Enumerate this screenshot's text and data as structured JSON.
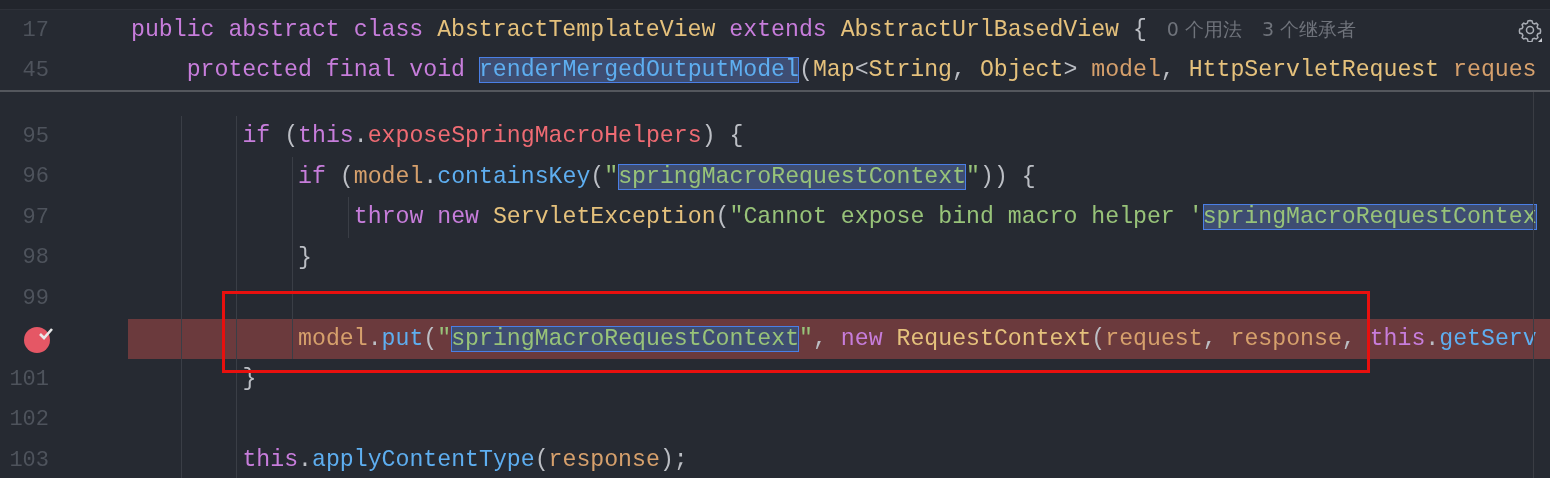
{
  "sticky_lines": [
    {
      "number": "17",
      "tokens": [
        {
          "kind": "kw",
          "text": "public abstract class "
        },
        {
          "kind": "cls",
          "text": "AbstractTemplateView "
        },
        {
          "kind": "kw",
          "text": "extends "
        },
        {
          "kind": "cls",
          "text": "AbstractUrlBasedView "
        },
        {
          "kind": "plain",
          "text": "{"
        }
      ],
      "hints": [
        "0 个用法",
        "3 个继承者"
      ],
      "children": [
        {
          "number": "45",
          "tokens": [
            {
              "kind": "kw",
              "text": "protected final void "
            },
            {
              "kind": "method",
              "text": "renderMergedOutputModel",
              "highlight": true
            },
            {
              "kind": "plain",
              "text": "("
            },
            {
              "kind": "cls",
              "text": "Map"
            },
            {
              "kind": "plain",
              "text": "<"
            },
            {
              "kind": "cls",
              "text": "String"
            },
            {
              "kind": "plain",
              "text": ", "
            },
            {
              "kind": "cls",
              "text": "Object"
            },
            {
              "kind": "plain",
              "text": "> "
            },
            {
              "kind": "param",
              "text": "model"
            },
            {
              "kind": "plain",
              "text": ", "
            },
            {
              "kind": "cls",
              "text": "HttpServletRequest "
            },
            {
              "kind": "param",
              "text": "reques"
            }
          ]
        }
      ]
    }
  ],
  "lines": [
    {
      "number": "95",
      "breakpoint": false,
      "tokens": [
        {
          "kind": "kw",
          "text": "if "
        },
        {
          "kind": "plain",
          "text": "("
        },
        {
          "kind": "kw",
          "text": "this"
        },
        {
          "kind": "plain",
          "text": "."
        },
        {
          "kind": "field",
          "text": "exposeSpringMacroHelpers"
        },
        {
          "kind": "plain",
          "text": ") {"
        }
      ],
      "children": [
        {
          "number": "96",
          "breakpoint": false,
          "tokens": [
            {
              "kind": "kw",
              "text": "if "
            },
            {
              "kind": "plain",
              "text": "("
            },
            {
              "kind": "param",
              "text": "model"
            },
            {
              "kind": "plain",
              "text": "."
            },
            {
              "kind": "method",
              "text": "containsKey"
            },
            {
              "kind": "plain",
              "text": "("
            },
            {
              "kind": "str",
              "text": "\""
            },
            {
              "kind": "str",
              "text": "springMacroRequestContext",
              "highlight": true
            },
            {
              "kind": "str",
              "text": "\""
            },
            {
              "kind": "plain",
              "text": ")) {"
            }
          ],
          "children": [
            {
              "number": "97",
              "breakpoint": false,
              "tokens": [
                {
                  "kind": "kw",
                  "text": "throw new "
                },
                {
                  "kind": "cls",
                  "text": "ServletException"
                },
                {
                  "kind": "plain",
                  "text": "("
                },
                {
                  "kind": "str",
                  "text": "\"Cannot expose bind macro helper '"
                },
                {
                  "kind": "str",
                  "text": "springMacroRequestContex",
                  "highlight": true
                }
              ]
            }
          ]
        },
        {
          "number": "98",
          "breakpoint": false,
          "tokens": [
            {
              "kind": "plain",
              "text": "}"
            }
          ]
        },
        {
          "number": "99",
          "breakpoint": false
        },
        {
          "breakpoint": true,
          "tokens": [
            {
              "kind": "param",
              "text": "model"
            },
            {
              "kind": "plain",
              "text": "."
            },
            {
              "kind": "method",
              "text": "put"
            },
            {
              "kind": "plain",
              "text": "("
            },
            {
              "kind": "str",
              "text": "\""
            },
            {
              "kind": "str",
              "text": "springMacroRequestContext",
              "highlight": true
            },
            {
              "kind": "str",
              "text": "\""
            },
            {
              "kind": "plain",
              "text": ", "
            },
            {
              "kind": "kw",
              "text": "new "
            },
            {
              "kind": "cls",
              "text": "RequestContext"
            },
            {
              "kind": "plain",
              "text": "("
            },
            {
              "kind": "param",
              "text": "request"
            },
            {
              "kind": "plain",
              "text": ", "
            },
            {
              "kind": "param",
              "text": "response"
            },
            {
              "kind": "plain",
              "text": ", "
            },
            {
              "kind": "kw",
              "text": "this"
            },
            {
              "kind": "plain",
              "text": "."
            },
            {
              "kind": "method",
              "text": "getServ"
            }
          ]
        }
      ]
    },
    {
      "number": "101",
      "breakpoint": false,
      "tokens": [
        {
          "kind": "plain",
          "text": "}"
        }
      ]
    },
    {
      "number": "102",
      "breakpoint": false
    },
    {
      "number": "103",
      "breakpoint": false,
      "tokens": [
        {
          "kind": "kw",
          "text": "this"
        },
        {
          "kind": "plain",
          "text": "."
        },
        {
          "kind": "method",
          "text": "applyContentType"
        },
        {
          "kind": "plain",
          "text": "("
        },
        {
          "kind": "param",
          "text": "response"
        },
        {
          "kind": "plain",
          "text": ");"
        }
      ]
    }
  ]
}
